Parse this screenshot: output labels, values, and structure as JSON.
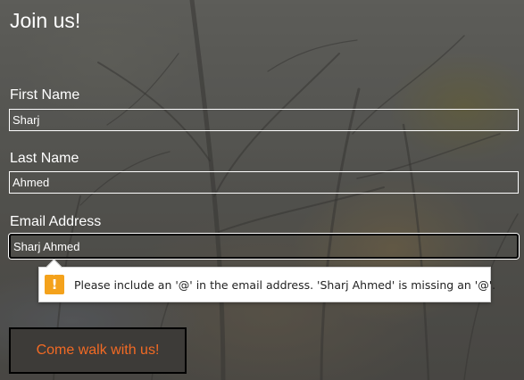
{
  "form": {
    "title": "Join us!",
    "fields": [
      {
        "label": "First Name",
        "value": "Sharj"
      },
      {
        "label": "Last Name",
        "value": "Ahmed"
      },
      {
        "label": "Email Address",
        "value": "Sharj Ahmed"
      }
    ],
    "validation_message": "Please include an '@' in the email address. 'Sharj Ahmed' is missing an '@'.",
    "submit_label": "Come walk with us!"
  },
  "colors": {
    "accent": "#f26a24",
    "warning": "#f4a21c",
    "button_bg": "#3d3b38"
  },
  "icons": {
    "warning": "warning-icon"
  }
}
